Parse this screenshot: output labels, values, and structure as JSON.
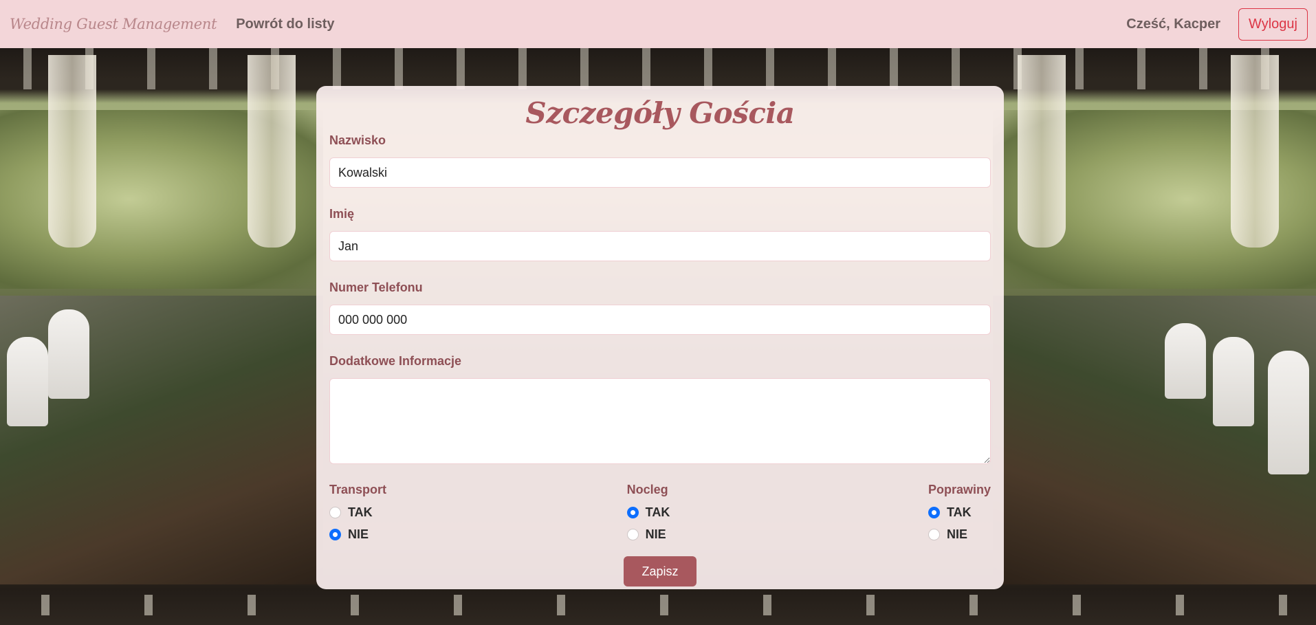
{
  "navbar": {
    "brand": "Wedding Guest Management",
    "back_link": "Powrót do listy",
    "greeting": "Cześć, Kacper",
    "logout": "Wyloguj"
  },
  "form": {
    "title": "Szczegóły Gościa",
    "fields": {
      "last_name": {
        "label": "Nazwisko",
        "value": "Kowalski"
      },
      "first_name": {
        "label": "Imię",
        "value": "Jan"
      },
      "phone": {
        "label": "Numer Telefonu",
        "value": "000 000 000"
      },
      "notes": {
        "label": "Dodatkowe Informacje",
        "value": ""
      }
    },
    "options": [
      {
        "label": "Transport",
        "yes": "TAK",
        "no": "NIE",
        "selected": "NIE"
      },
      {
        "label": "Nocleg",
        "yes": "TAK",
        "no": "NIE",
        "selected": "TAK"
      },
      {
        "label": "Poprawiny",
        "yes": "TAK",
        "no": "NIE",
        "selected": "TAK"
      }
    ],
    "submit": "Zapisz"
  },
  "colors": {
    "navbar_bg": "#f3d6d9",
    "accent": "#a8585e",
    "label": "#8e4f55",
    "danger": "#dc3545",
    "radio_checked": "#0d6efd"
  }
}
